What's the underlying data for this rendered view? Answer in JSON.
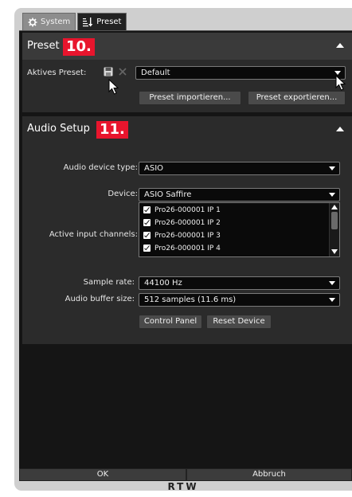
{
  "tabs": [
    {
      "label": "System",
      "icon": "gear-icon",
      "active": false
    },
    {
      "label": "Preset",
      "icon": "sort-icon",
      "active": true
    }
  ],
  "preset_panel": {
    "title": "Preset",
    "badge": "10.",
    "active_preset_label": "Aktives Preset:",
    "active_preset_value": "Default",
    "import_button": "Preset importieren...",
    "export_button": "Preset exportieren..."
  },
  "audio_panel": {
    "title": "Audio Setup",
    "badge": "11.",
    "device_type_label": "Audio device type:",
    "device_type_value": "ASIO",
    "device_label": "Device:",
    "device_value": "ASIO Saffire",
    "input_channels_label": "Active input channels:",
    "input_channels": [
      {
        "label": "Pro26-000001 IP 1",
        "checked": true
      },
      {
        "label": "Pro26-000001 IP 2",
        "checked": true
      },
      {
        "label": "Pro26-000001 IP 3",
        "checked": true
      },
      {
        "label": "Pro26-000001 IP 4",
        "checked": true
      }
    ],
    "sample_rate_label": "Sample rate:",
    "sample_rate_value": "44100 Hz",
    "buffer_size_label": "Audio buffer size:",
    "buffer_size_value": "512 samples (11.6 ms)",
    "control_panel_button": "Control Panel",
    "reset_device_button": "Reset Device"
  },
  "footer": {
    "ok_button": "OK",
    "cancel_button": "Abbruch",
    "logo": "RTW"
  },
  "colors": {
    "badge": "#e8152d",
    "panel": "#2b2b2b",
    "background": "#151515"
  }
}
